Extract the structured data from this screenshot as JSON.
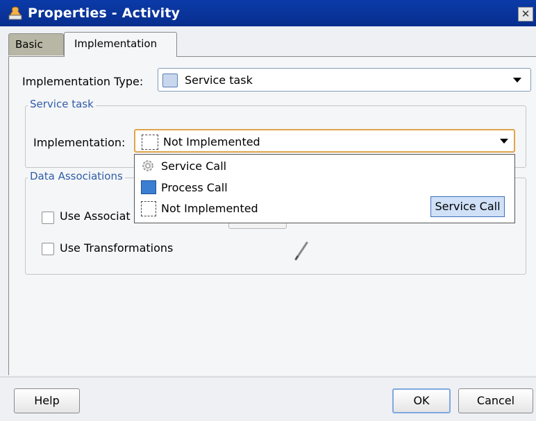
{
  "window": {
    "title": "Properties - Activity",
    "close_glyph": "✕"
  },
  "tabs": [
    {
      "label": "Basic"
    },
    {
      "label": "Implementation"
    }
  ],
  "implementation_type": {
    "label": "Implementation Type:",
    "value": "Service task"
  },
  "service_task": {
    "group_label": "Service task",
    "implementation_label": "Implementation:",
    "implementation_value": "Not Implemented",
    "options": [
      {
        "label": "Service Call",
        "icon": "gear-icon"
      },
      {
        "label": "Process Call",
        "icon": "process-icon"
      },
      {
        "label": "Not Implemented",
        "icon": "dashed-box-icon"
      }
    ],
    "tooltip": "Service Call"
  },
  "data_associations": {
    "group_label": "Data Associations",
    "use_associations_label": "Use Associat",
    "use_transformations_label": "Use Transformations",
    "use_associations_checked": false,
    "use_transformations_checked": false
  },
  "buttons": {
    "help": "Help",
    "ok": "OK",
    "cancel": "Cancel"
  }
}
